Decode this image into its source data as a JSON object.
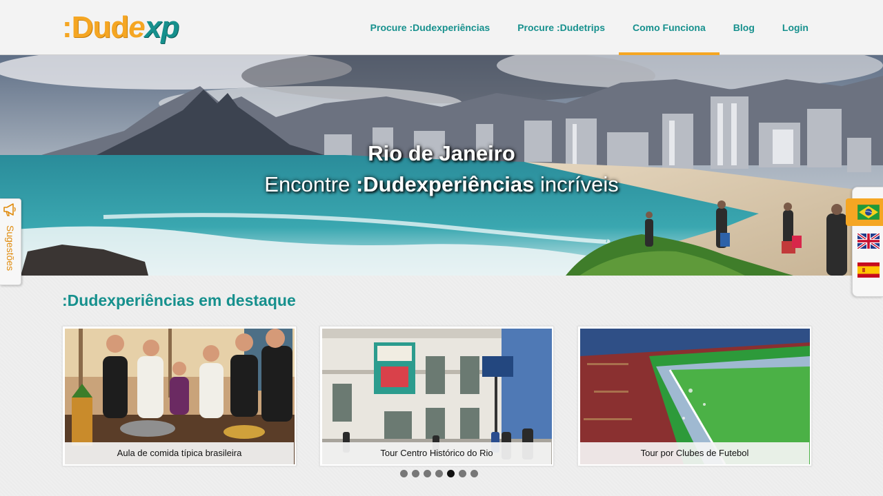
{
  "logo": {
    "colon": ":",
    "dud": "Dud",
    "e": "e",
    "xp": "xp"
  },
  "nav": [
    {
      "label": "Procure :Dudexperiências"
    },
    {
      "label": "Procure :Dudetrips"
    },
    {
      "label": "Como Funciona",
      "active": true
    },
    {
      "label": "Blog"
    },
    {
      "label": "Login"
    }
  ],
  "hero": {
    "title": "Rio de Janeiro",
    "subtitle_prefix": "Encontre ",
    "subtitle_brand": ":Dudexperiências",
    "subtitle_suffix": " incríveis"
  },
  "suggestions": {
    "label": "Sugestões",
    "icon": "megaphone-icon"
  },
  "languages": [
    {
      "name": "brazil-flag-icon",
      "active": true
    },
    {
      "name": "uk-flag-icon",
      "active": false
    },
    {
      "name": "spain-flag-icon",
      "active": false
    }
  ],
  "featured": {
    "title": ":Dudexperiências em destaque",
    "cards": [
      {
        "caption": "Aula de comida típica brasileira"
      },
      {
        "caption": "Tour Centro Histórico do Rio"
      },
      {
        "caption": "Tour por Clubes de Futebol"
      }
    ],
    "carousel": {
      "total": 7,
      "active_index": 4
    }
  },
  "colors": {
    "accent": "#f5a623",
    "teal": "#16908d"
  }
}
